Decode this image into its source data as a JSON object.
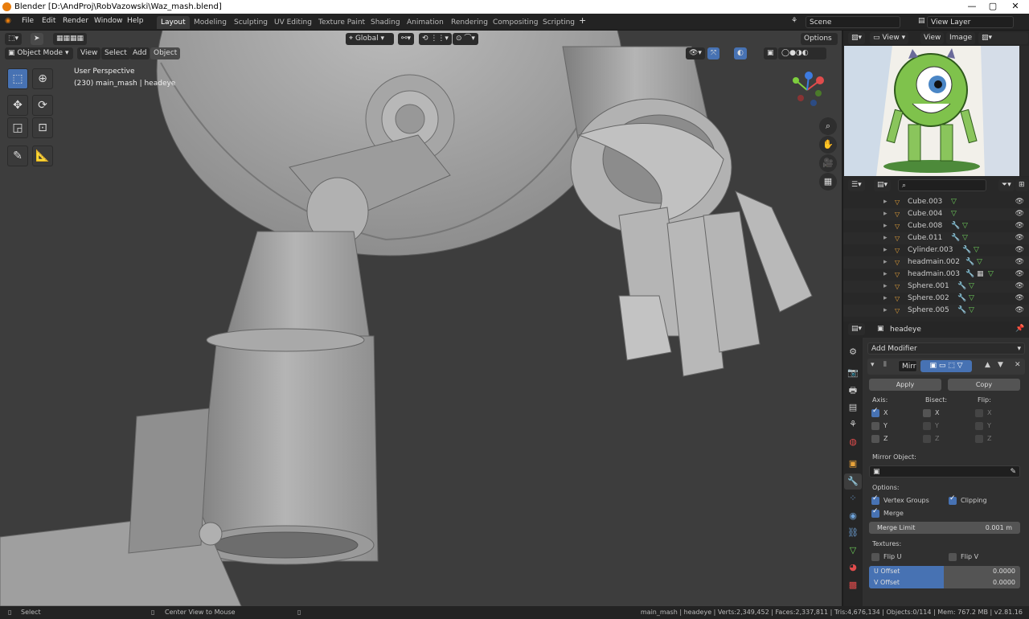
{
  "window": {
    "title": "Blender [D:\\AndProj\\RobVazowski\\Waz_mash.blend]"
  },
  "menu": [
    "File",
    "Edit",
    "Render",
    "Window",
    "Help"
  ],
  "workspaces": [
    "Layout",
    "Modeling",
    "Sculpting",
    "UV Editing",
    "Texture Paint",
    "Shading",
    "Animation",
    "Rendering",
    "Compositing",
    "Scripting"
  ],
  "scene": "Scene",
  "view_layer": "View Layer",
  "viewport": {
    "mode": "Object Mode",
    "menus": [
      "View",
      "Select",
      "Add",
      "Object"
    ],
    "orientation": "Global",
    "options": "Options",
    "perspective": "User Perspective",
    "info": "(230) main_mash | headeye"
  },
  "image_editor": {
    "menus": [
      "View",
      "View",
      "Image"
    ],
    "image_name": "9ec1489"
  },
  "outliner": {
    "items": [
      "Cube.003",
      "Cube.004",
      "Cube.008",
      "Cube.011",
      "Cylinder.003",
      "headmain.002",
      "headmain.003",
      "Sphere.001",
      "Sphere.002",
      "Sphere.005"
    ]
  },
  "properties": {
    "object": "headeye",
    "add_modifier": "Add Modifier",
    "modifier_name": "Mirr",
    "apply": "Apply",
    "copy": "Copy",
    "axis": "Axis:",
    "bisect": "Bisect:",
    "flip": "Flip:",
    "x": "X",
    "y": "Y",
    "z": "Z",
    "mirror_object": "Mirror Object:",
    "options": "Options:",
    "vertex_groups": "Vertex Groups",
    "clipping": "Clipping",
    "merge": "Merge",
    "merge_limit": "Merge Limit",
    "merge_limit_value": "0.001 m",
    "textures": "Textures:",
    "flip_u": "Flip U",
    "flip_v": "Flip V",
    "u_offset": "U Offset",
    "u_value": "0.0000",
    "v_offset": "V Offset",
    "v_value": "0.0000"
  },
  "status": {
    "select": "Select",
    "center": "Center View to Mouse",
    "stats": "main_mash | headeye | Verts:2,349,452 | Faces:2,337,811 | Tris:4,676,134 | Objects:0/114 | Mem: 767.2 MB | v2.81.16"
  }
}
